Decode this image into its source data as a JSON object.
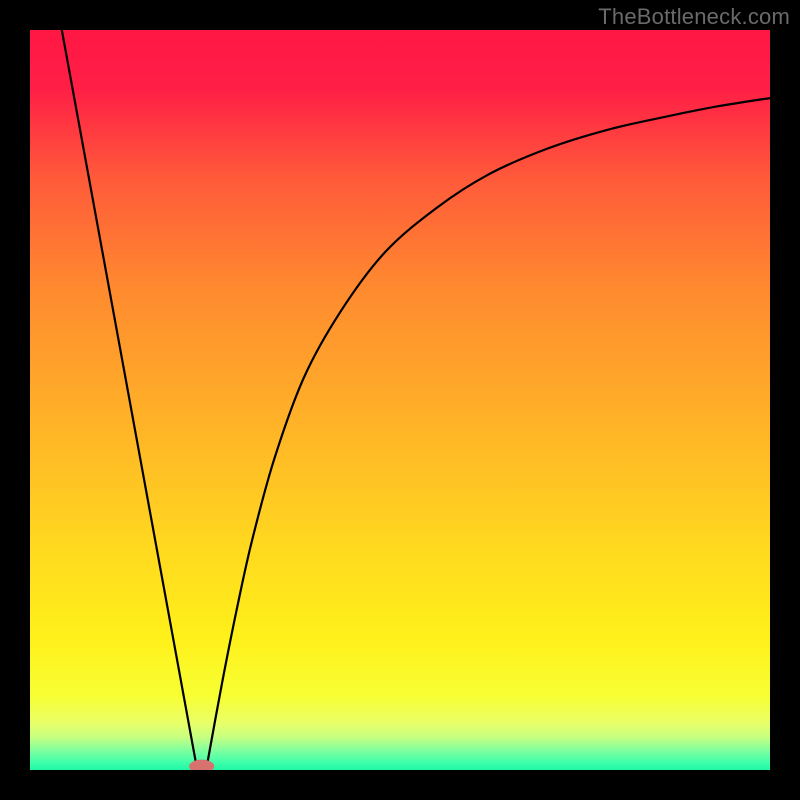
{
  "watermark": "TheBottleneck.com",
  "chart_data": {
    "type": "line",
    "title": "",
    "xlabel": "",
    "ylabel": "",
    "xlim": [
      0,
      100
    ],
    "ylim": [
      0,
      100
    ],
    "grid": false,
    "legend": false,
    "background": {
      "gradient_stops": [
        {
          "pos": 0.0,
          "color": "#ff1744"
        },
        {
          "pos": 0.08,
          "color": "#ff1f46"
        },
        {
          "pos": 0.2,
          "color": "#ff5a3a"
        },
        {
          "pos": 0.35,
          "color": "#ff8a2f"
        },
        {
          "pos": 0.52,
          "color": "#ffb028"
        },
        {
          "pos": 0.7,
          "color": "#ffd91f"
        },
        {
          "pos": 0.82,
          "color": "#fff01a"
        },
        {
          "pos": 0.9,
          "color": "#f7ff33"
        },
        {
          "pos": 0.935,
          "color": "#eaff66"
        },
        {
          "pos": 0.955,
          "color": "#c9ff80"
        },
        {
          "pos": 0.975,
          "color": "#7affa0"
        },
        {
          "pos": 0.99,
          "color": "#3effaa"
        },
        {
          "pos": 1.0,
          "color": "#20f7a6"
        }
      ]
    },
    "series": [
      {
        "name": "left-descent",
        "x": [
          4.3,
          22.6
        ],
        "values": [
          100,
          0
        ]
      },
      {
        "name": "right-curve",
        "x": [
          23.8,
          26,
          28,
          30,
          33,
          37,
          42,
          48,
          55,
          62,
          70,
          78,
          86,
          93,
          100
        ],
        "values": [
          0,
          12,
          22,
          31,
          42,
          53,
          62,
          70,
          76,
          80.5,
          84,
          86.5,
          88.3,
          89.7,
          90.8
        ]
      }
    ],
    "marker": {
      "cx": 23.2,
      "cy": 0.5,
      "rx": 1.7,
      "ry": 0.9,
      "fill": "#d8726e"
    }
  }
}
